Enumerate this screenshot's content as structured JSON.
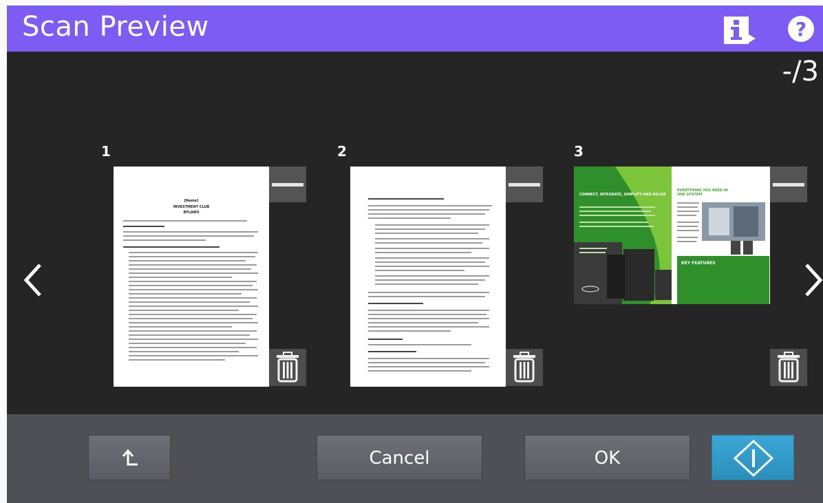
{
  "header": {
    "title": "Scan Preview",
    "info_icon": "info-icon",
    "help_icon": "help-icon",
    "help_glyph": "?"
  },
  "viewer": {
    "page_indicator": "-/3",
    "prev_icon": "chevron-left-icon",
    "next_icon": "chevron-right-icon",
    "pages": [
      {
        "number": "1",
        "doc_title_1": "[Name]",
        "doc_title_2": "INVESTMENT CLUB",
        "doc_title_3": "BYLAWS"
      },
      {
        "number": "2"
      },
      {
        "number": "3",
        "banner_left": "CONNECT, INTEGRATE, SIMPLIFY AND RELISE",
        "banner_right": "EVERYTHING YOU NEED IN ONE SYSTEM",
        "key_features": "KEY FEATURES"
      }
    ]
  },
  "footer": {
    "up_icon": "return-arrow-icon",
    "cancel_label": "Cancel",
    "ok_label": "OK",
    "start_icon": "start-diamond-icon"
  },
  "colors": {
    "header": "#7c5cf2",
    "start_button": "#3aa7d6",
    "viewer_bg": "#252525",
    "footer_bg": "#4e5056"
  }
}
